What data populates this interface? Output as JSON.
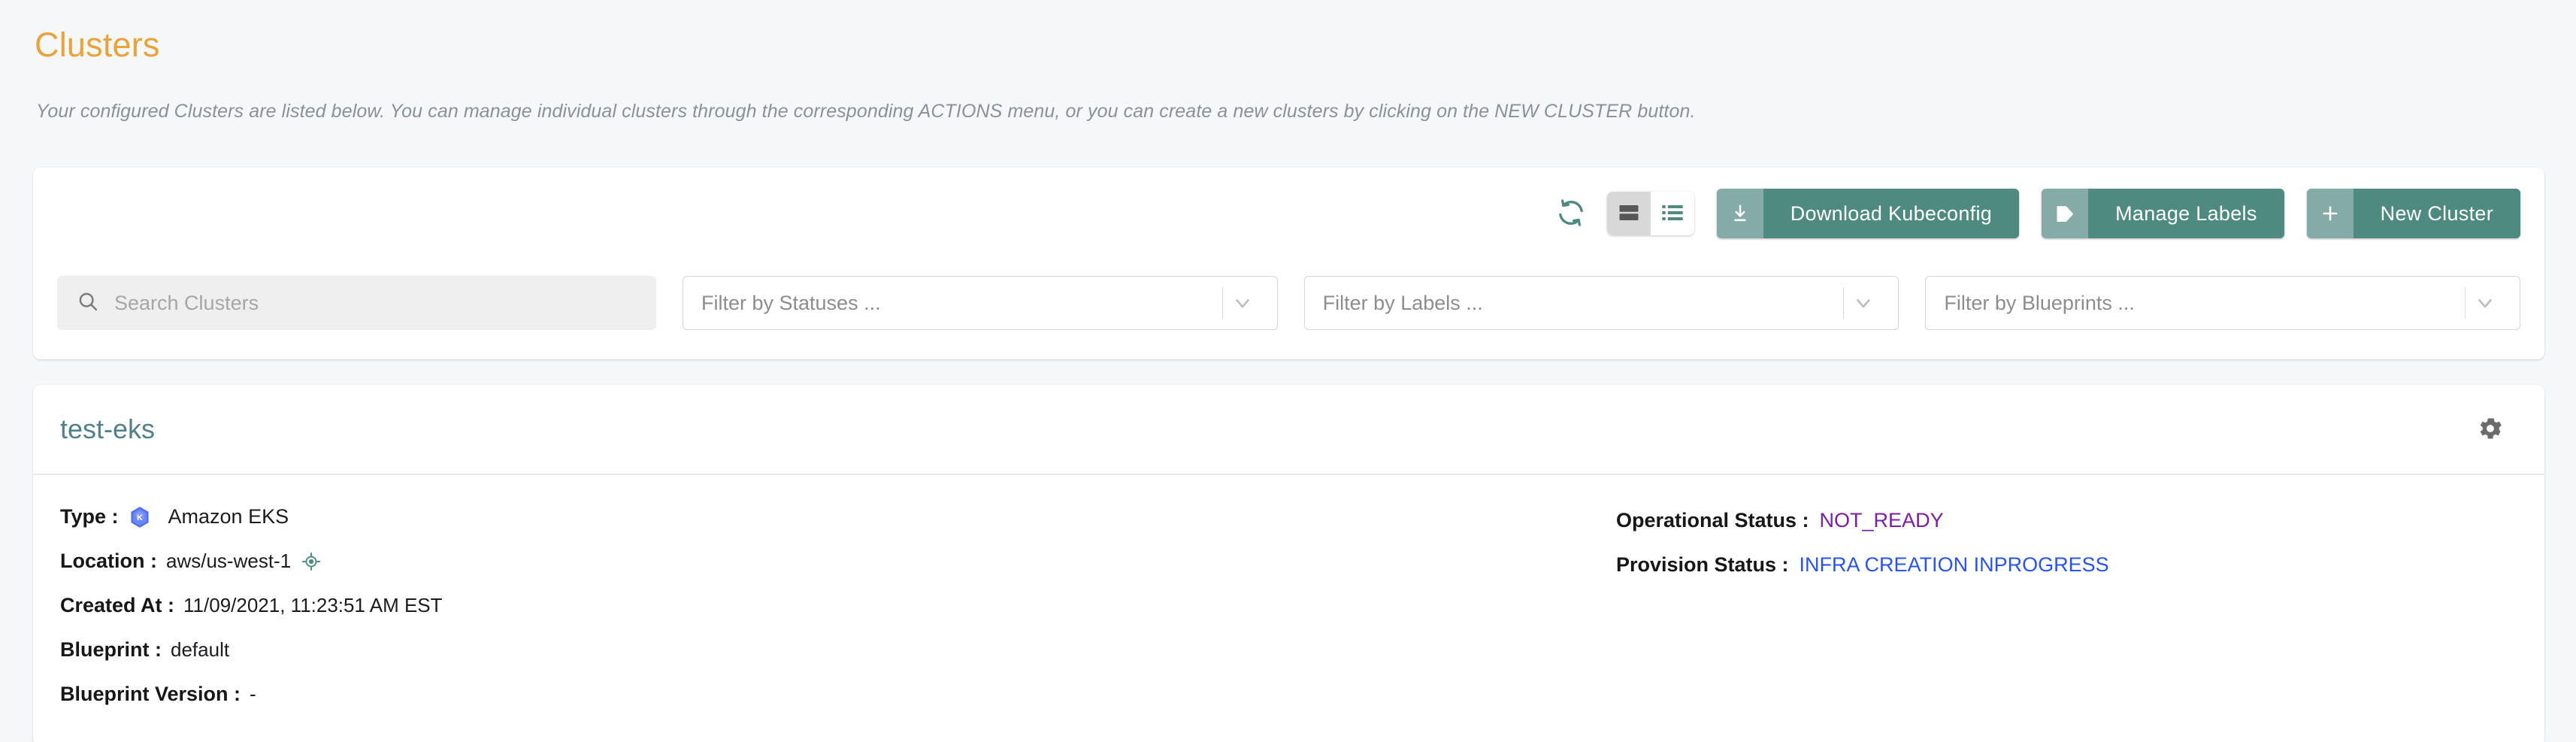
{
  "header": {
    "title": "Clusters",
    "description": "Your configured Clusters are listed below. You can manage individual clusters through the corresponding ACTIONS menu, or you can create a new clusters by clicking on the NEW CLUSTER button."
  },
  "toolbar": {
    "refresh_icon": "refresh-icon",
    "view_toggle": {
      "card_view_icon": "card-view-icon",
      "list_view_icon": "list-view-icon",
      "active": "card"
    },
    "buttons": [
      {
        "label": "Download Kubeconfig",
        "icon": "download-icon",
        "name": "download-kubeconfig-button"
      },
      {
        "label": "Manage Labels",
        "icon": "tag-icon",
        "name": "manage-labels-button"
      },
      {
        "label": "New Cluster",
        "icon": "plus-icon",
        "name": "new-cluster-button"
      }
    ]
  },
  "filters": {
    "search": {
      "placeholder": "Search Clusters",
      "value": "",
      "icon": "search-icon"
    },
    "selects": [
      {
        "label": "Filter by Statuses ...",
        "name": "filter-statuses-select"
      },
      {
        "label": "Filter by Labels ...",
        "name": "filter-labels-select"
      },
      {
        "label": "Filter by Blueprints ...",
        "name": "filter-blueprints-select"
      }
    ]
  },
  "cluster": {
    "name": "test-eks",
    "settings_icon": "gear-icon",
    "details": {
      "type_key": "Type :",
      "type_value": "Amazon EKS",
      "type_icon": "kubernetes-hexagon-icon",
      "location_key": "Location :",
      "location_value": "aws/us-west-1",
      "location_icon": "target-location-icon",
      "created_key": "Created At :",
      "created_value": "11/09/2021, 11:23:51 AM EST",
      "blueprint_key": "Blueprint :",
      "blueprint_value": "default",
      "blueprint_version_key": "Blueprint Version :",
      "blueprint_version_value": "-"
    },
    "status": {
      "operational_key": "Operational Status :",
      "operational_value": "NOT_READY",
      "operational_color": "#7a1fa2",
      "provision_key": "Provision Status :",
      "provision_value": "INFRA CREATION INPROGRESS",
      "provision_color": "#2953f0"
    }
  },
  "colors": {
    "page_background": "#f5f7f9",
    "title_accent": "#e8a33d",
    "button_primary": "#4f8a80",
    "button_primary_light": "#84aba5",
    "card_title": "#52808a",
    "teal_icon": "#4f8a80"
  }
}
